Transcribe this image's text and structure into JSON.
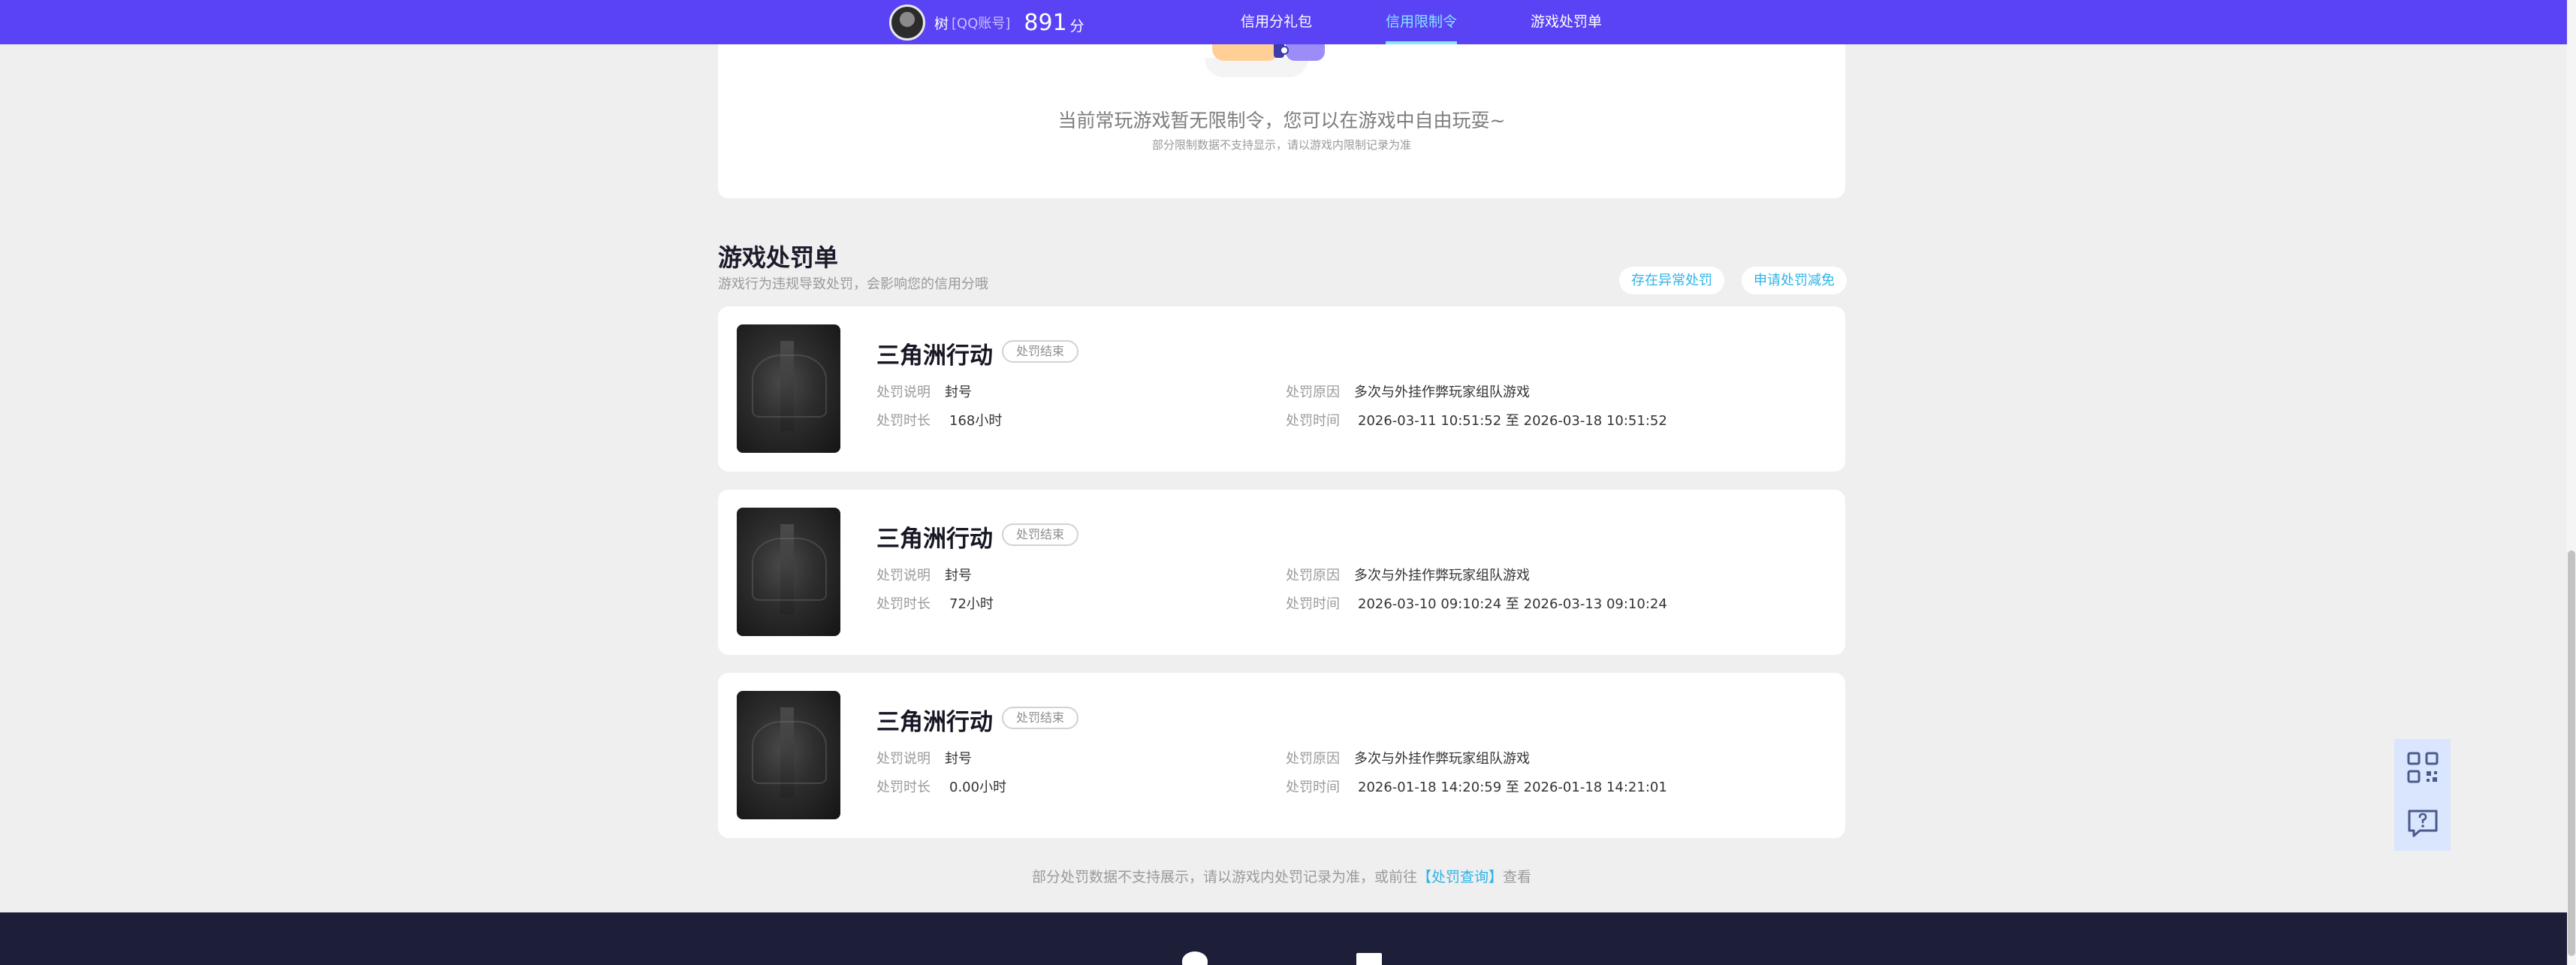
{
  "header": {
    "username": "树",
    "account_type": "[QQ账号]",
    "score": "891",
    "score_unit": "分",
    "tabs": [
      {
        "label": "信用分礼包"
      },
      {
        "label": "信用限制令"
      },
      {
        "label": "游戏处罚单"
      }
    ]
  },
  "restriction": {
    "message": "当前常玩游戏暂无限制令，您可以在游戏中自由玩耍~",
    "note": "部分限制数据不支持显示，请以游戏内限制记录为准"
  },
  "penalty_section": {
    "title": "游戏处罚单",
    "description": "游戏行为违规导致处罚，会影响您的信用分哦",
    "buttons": {
      "abnormal": "存在异常处罚",
      "appeal": "申请处罚减免"
    }
  },
  "field_labels": {
    "description": "处罚说明",
    "duration": "处罚时长",
    "reason": "处罚原因",
    "time": "处罚时间"
  },
  "penalties": [
    {
      "game": "三角洲行动",
      "status": "处罚结束",
      "description": "封号",
      "duration": "168小时",
      "reason": "多次与外挂作弊玩家组队游戏",
      "time": "2026-03-11 10:51:52 至 2026-03-18 10:51:52"
    },
    {
      "game": "三角洲行动",
      "status": "处罚结束",
      "description": "封号",
      "duration": "72小时",
      "reason": "多次与外挂作弊玩家组队游戏",
      "time": "2026-03-10 09:10:24 至 2026-03-13 09:10:24"
    },
    {
      "game": "三角洲行动",
      "status": "处罚结束",
      "description": "封号",
      "duration": "0.00小时",
      "reason": "多次与外挂作弊玩家组队游戏",
      "time": "2026-01-18 14:20:59 至 2026-01-18 14:21:01"
    }
  ],
  "footer_note": {
    "prefix": "部分处罚数据不支持展示，请以游戏内处罚记录为准，或前往",
    "link": "【处罚查询】",
    "suffix": "查看"
  },
  "colors": {
    "header_bg": "#5a42f5",
    "active_tab": "#86e6ff",
    "link": "#2fb4e8",
    "footer_bg": "#1d1e38"
  },
  "icons": [
    "avatar",
    "qr-code-icon",
    "feedback-icon",
    "wechat-icon",
    "mail-icon"
  ]
}
